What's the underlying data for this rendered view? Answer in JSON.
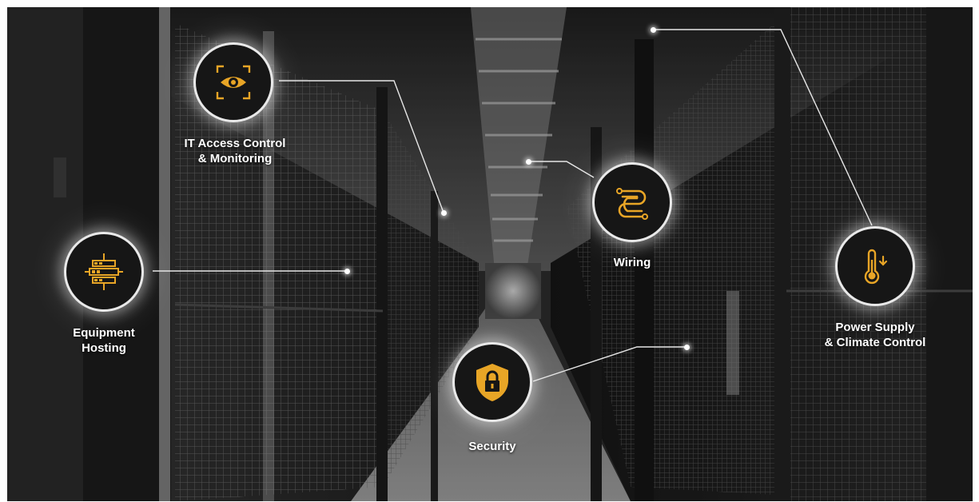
{
  "features": [
    {
      "id": "it-access",
      "line1": "IT Access Control",
      "line2": "& Monitoring",
      "icon": "eye-icon"
    },
    {
      "id": "wiring",
      "line1": "Wiring",
      "line2": "",
      "icon": "wiring-icon"
    },
    {
      "id": "equipment",
      "line1": "Equipment",
      "line2": "Hosting",
      "icon": "server-rack-icon"
    },
    {
      "id": "power",
      "line1": "Power Supply",
      "line2": "& Climate Control",
      "icon": "thermometer-icon"
    },
    {
      "id": "security",
      "line1": "Security",
      "line2": "",
      "icon": "shield-lock-icon"
    }
  ],
  "colors": {
    "accent": "#e8a526",
    "node_bg": "#161616",
    "line": "#e6e6e6"
  }
}
